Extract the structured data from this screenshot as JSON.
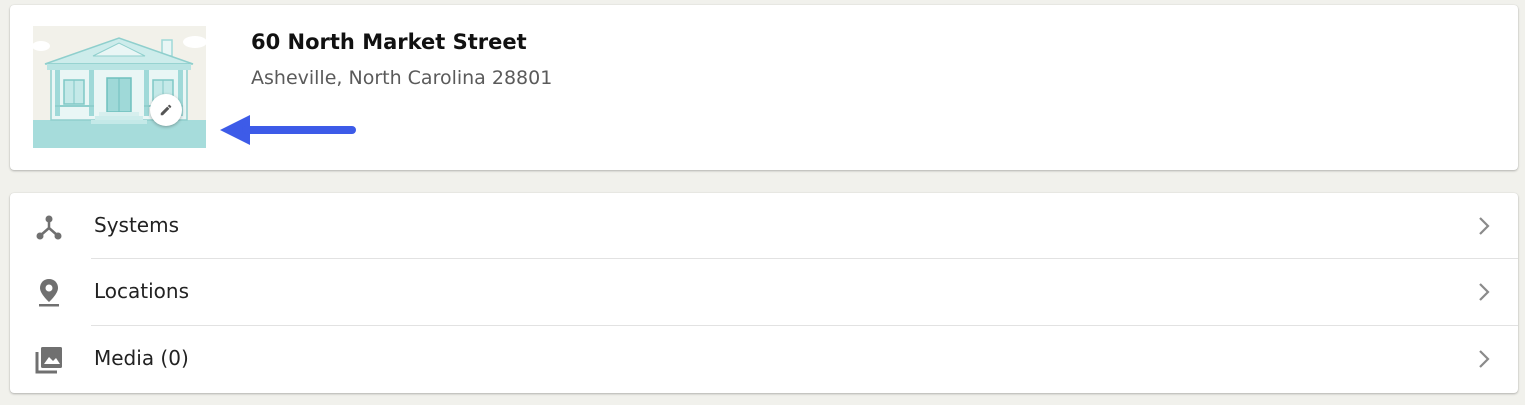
{
  "property": {
    "title": "60 North Market Street",
    "subtitle": "Asheville, North Carolina 28801"
  },
  "menu": {
    "items": [
      {
        "label": "Systems",
        "icon": "systems-icon"
      },
      {
        "label": "Locations",
        "icon": "location-pin-icon"
      },
      {
        "label": "Media (0)",
        "icon": "media-icon"
      }
    ]
  },
  "colors": {
    "accent_arrow": "#3d5be8",
    "house_teal": "#9fd9d8",
    "background": "#f1f1ec"
  }
}
